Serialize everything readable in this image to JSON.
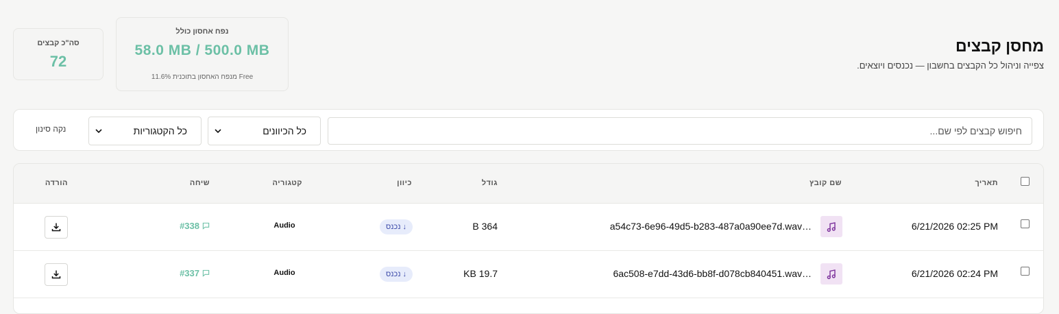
{
  "header": {
    "title": "מחסן קבצים",
    "subtitle": "צפייה וניהול כל הקבצים בחשבון — נכנסים ויוצאים."
  },
  "stats": {
    "storage": {
      "label": "נפח אחסון כולל",
      "value": "58.0 MB / 500.0 MB",
      "note": "11.6% מנפח האחסון בתוכנית Free",
      "usage_fraction": 0.116
    },
    "total": {
      "label": "סה\"כ קבצים",
      "value": "72"
    }
  },
  "filters": {
    "search_placeholder": "חיפוש קבצים לפי שם...",
    "direction_select": "כל הכיוונים",
    "category_select": "כל הקטגוריות",
    "clear_label": "נקה סינון"
  },
  "table": {
    "columns": {
      "date": "תאריך",
      "filename": "שם קובץ",
      "size": "גודל",
      "direction": "כיוון",
      "category": "קטגוריה",
      "conversation": "שיחה",
      "download": "הורדה"
    },
    "rows": [
      {
        "date": "6/21/2026 02:25 PM",
        "filename": "a54c73-6e96-49d5-b283-487a0a90ee7d.wav…",
        "size": "364 B",
        "direction": "↓ נכנס",
        "category": "Audio",
        "conversation": "#338"
      },
      {
        "date": "6/21/2026 02:24 PM",
        "filename": "6ac508-e7dd-43d6-bb8f-d078cb840451.wav…",
        "size": "19.7 KB",
        "direction": "↓ נכנס",
        "category": "Audio",
        "conversation": "#337"
      }
    ]
  },
  "icons": {
    "file_type": "music-note-icon",
    "conversation": "chat-bubble-icon",
    "download": "download-icon",
    "select": "chevron-down-icon"
  },
  "colors": {
    "accent": "#6cc0a6",
    "file_icon_bg": "#f1e2f4",
    "file_icon": "#7a2e9a",
    "incoming_badge_bg": "#e7ecfb",
    "incoming_badge_text": "#3a48a8"
  }
}
